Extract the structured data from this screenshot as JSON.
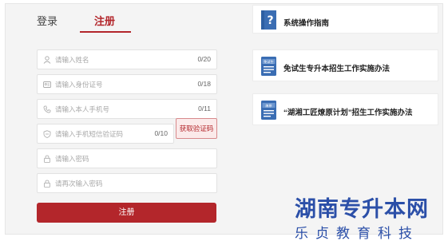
{
  "tabs": {
    "login": "登录",
    "register": "注册"
  },
  "form": {
    "name": {
      "placeholder": "请输入姓名",
      "count": "0/20"
    },
    "id_number": {
      "placeholder": "请输入身份证号",
      "count": "0/18"
    },
    "phone": {
      "placeholder": "请输入本人手机号",
      "count": "0/11"
    },
    "sms_code": {
      "placeholder": "请输入手机短信验证码",
      "count": "0/10"
    },
    "get_code_label": "获取验证码",
    "password": {
      "placeholder": "请输入密码"
    },
    "password_confirm": {
      "placeholder": "请再次输入密码"
    },
    "submit_label": "注册"
  },
  "panels": [
    {
      "title": "系统操作指南",
      "icon": "help-doc-icon"
    },
    {
      "title": "免试生专升本招生工作实施办法",
      "icon": "doc-icon",
      "icon_label": "免试生"
    },
    {
      "title": "“湖湘工匠燎原计划”招生工作实施办法",
      "icon": "doc-icon",
      "icon_label": "燎原"
    }
  ],
  "watermark": {
    "top": "湖南专升本网",
    "bottom": "乐贞教育科技"
  },
  "colors": {
    "accent": "#b3262b",
    "watermark": "#2b4fa8",
    "icon": "#3a6db3"
  }
}
